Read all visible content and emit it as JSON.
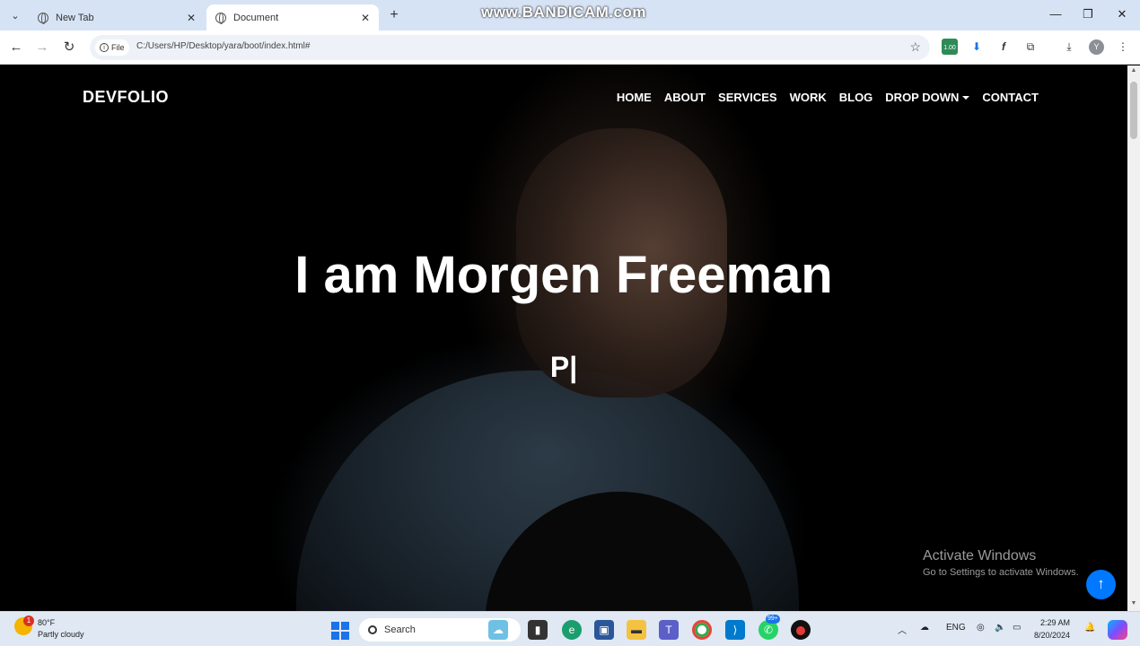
{
  "browser": {
    "tabs": [
      {
        "title": "New Tab",
        "active": false
      },
      {
        "title": "Document",
        "active": true
      }
    ],
    "watermark": "www.BANDICAM.com",
    "url_chip": "File",
    "url": "C:/Users/HP/Desktop/yara/boot/index.html#",
    "extension_badge": "1.00",
    "profile_initial": "Y"
  },
  "site": {
    "brand": "DEVFOLIO",
    "nav": {
      "home": "HOME",
      "about": "ABOUT",
      "services": "SERVICES",
      "work": "WORK",
      "blog": "BLOG",
      "dropdown": "DROP DOWN",
      "contact": "CONTACT"
    },
    "hero_title": "I am Morgen Freeman",
    "typed_text": "P|",
    "back_to_top_icon": "arrow-up-icon"
  },
  "windows_activation": {
    "line1": "Activate Windows",
    "line2": "Go to Settings to activate Windows."
  },
  "taskbar": {
    "weather_badge": "1",
    "temperature": "80°F",
    "condition": "Partly cloudy",
    "search_label": "Search",
    "whatsapp_badge": "99+",
    "language": "ENG",
    "time": "2:29 AM",
    "date": "8/20/2024"
  },
  "colors": {
    "accent": "#0078ff",
    "tabbar": "#d6e3f5",
    "page_bg": "#000000"
  }
}
